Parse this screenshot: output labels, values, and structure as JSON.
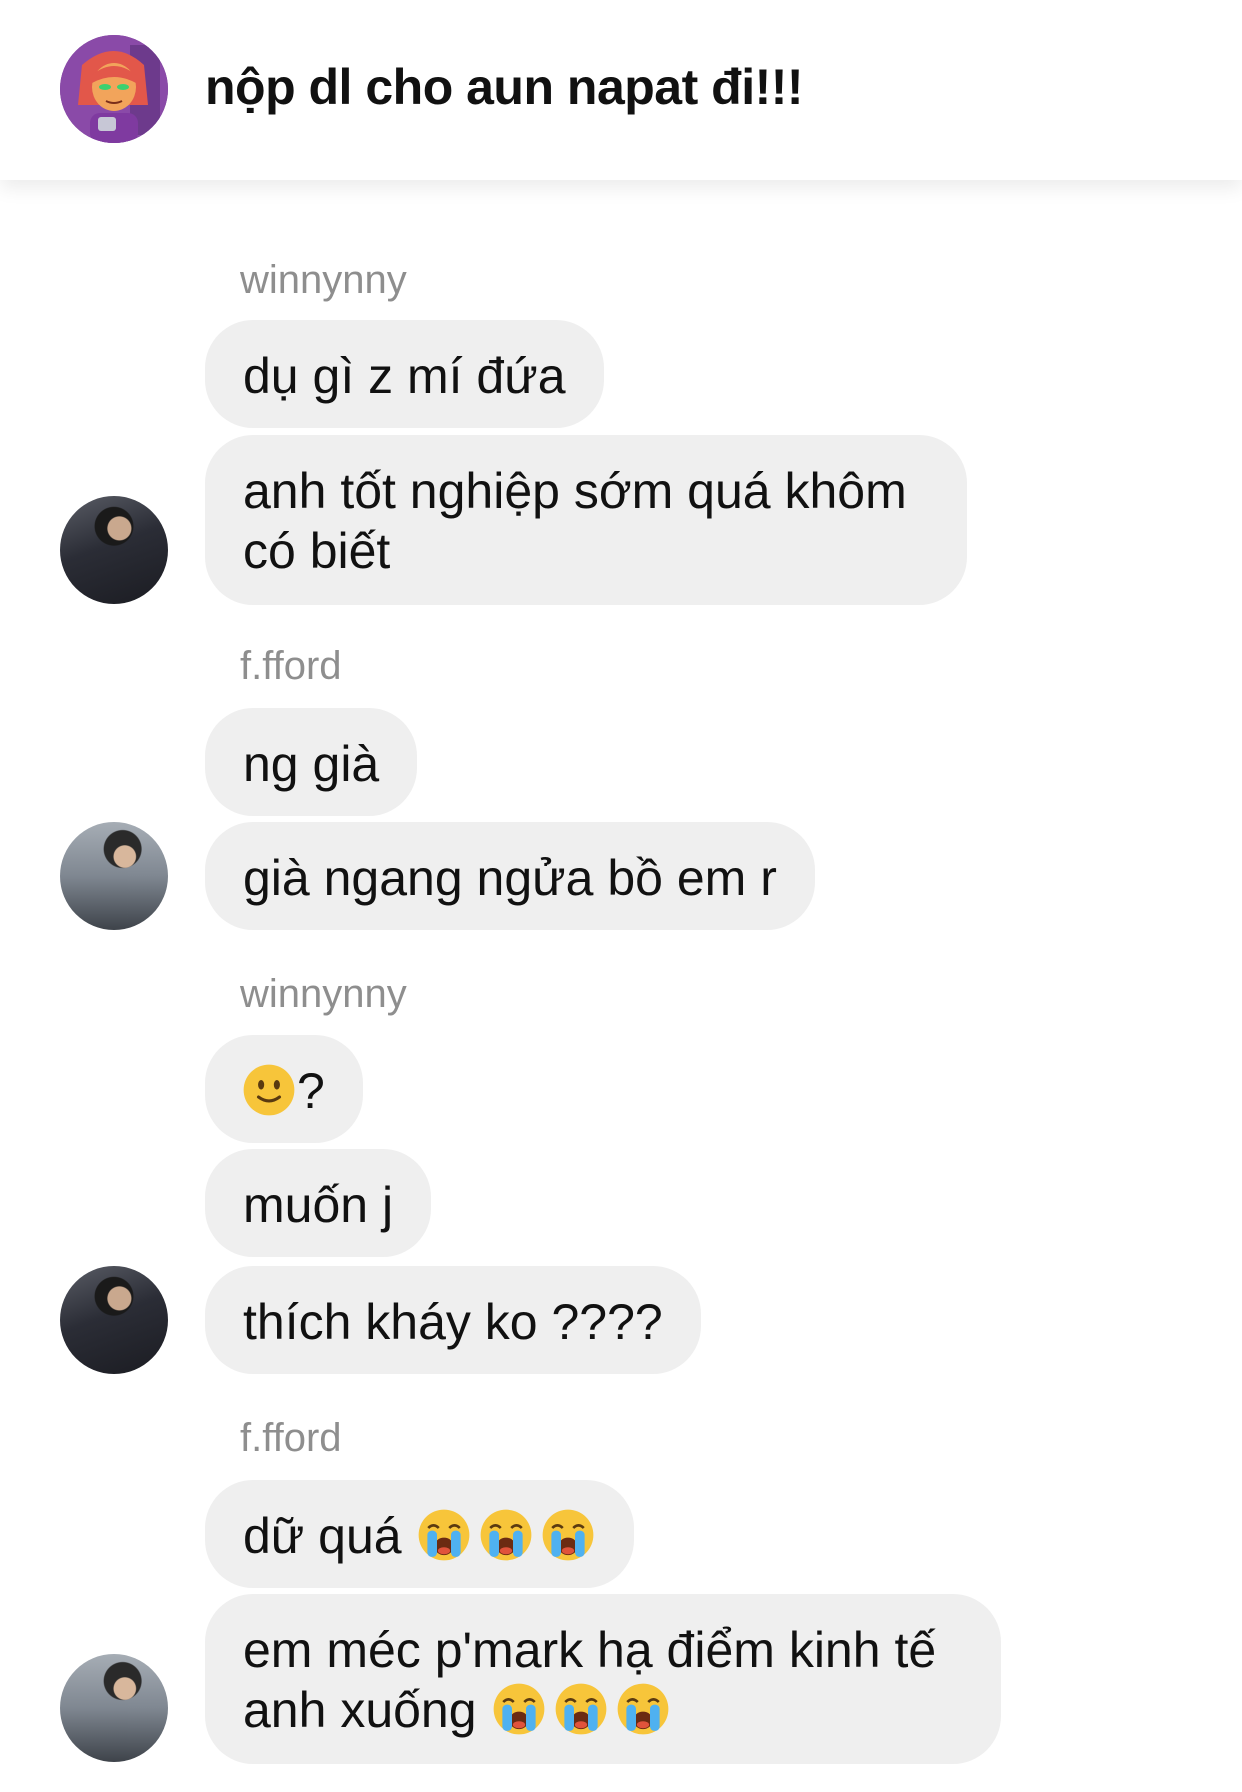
{
  "header": {
    "title": "nộp dl cho aun napat đi!!!"
  },
  "colors": {
    "bubble_bg": "#efefef",
    "sender_name": "#8e8e8e",
    "text": "#111111",
    "emoji_face": "#f7c53a"
  },
  "messages": [
    {
      "sender": "winnynny",
      "bubbles": [
        {
          "text": "dụ gì z mí đứa"
        },
        {
          "line1": "anh tốt nghiệp sớm quá khôm",
          "line2": "có biết"
        }
      ]
    },
    {
      "sender": "f.fford",
      "bubbles": [
        {
          "text": "ng già"
        },
        {
          "text": "già ngang ngửa bồ em r"
        }
      ]
    },
    {
      "sender": "winnynny",
      "bubbles": [
        {
          "emoji": "slightly-smiling-face-emoji",
          "text": "?"
        },
        {
          "text": "muốn j"
        },
        {
          "text": "thích kháy ko ????"
        }
      ]
    },
    {
      "sender": "f.fford",
      "bubbles": [
        {
          "text": "dữ quá",
          "emoji": "loudly-crying-face-emoji",
          "emoji_count": 3
        },
        {
          "line1": "em méc p'mark hạ điểm kinh tế",
          "line2": "anh xuống",
          "emoji": "loudly-crying-face-emoji",
          "emoji_count": 3
        }
      ]
    }
  ]
}
